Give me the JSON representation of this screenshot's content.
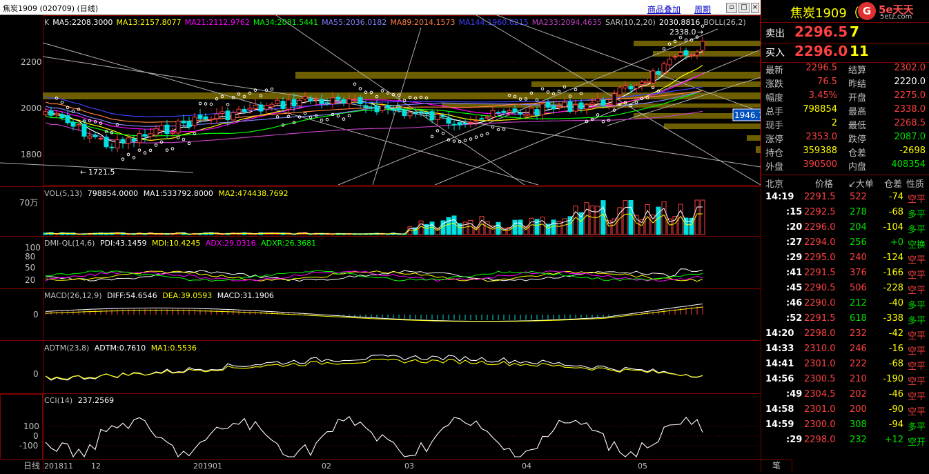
{
  "topbar": {
    "title": "焦炭1909 (020709) (日线)",
    "overlay_link": "商品叠加",
    "period_link": "周期"
  },
  "main_chart": {
    "indicator_line": [
      {
        "text": "K",
        "color": "#c0c0c0"
      },
      {
        "text": "MA5:2208.3000",
        "color": "#ffffff"
      },
      {
        "text": "MA13:2157.8077",
        "color": "#ffff00"
      },
      {
        "text": "MA21:2112.9762",
        "color": "#ff00ff"
      },
      {
        "text": "MA34:2081.5441",
        "color": "#00ff00"
      },
      {
        "text": "MA55:2036.0182",
        "color": "#8080ff"
      },
      {
        "text": "MA89:2014.1573",
        "color": "#ff8040"
      },
      {
        "text": "MA144:1960.6215",
        "color": "#4040ff"
      },
      {
        "text": "MA233:2094.4635",
        "color": "#c040c0"
      },
      {
        "text": "SAR(10,2,20)",
        "color": "#c0c0c0"
      },
      {
        "text": "2030.8816",
        "color": "#ffffff"
      },
      {
        "text": "BOLL(26,2)",
        "color": "#c0c0c0"
      }
    ],
    "y_ticks": [
      "2200",
      "2000",
      "1800"
    ],
    "high_label": "2338.0",
    "low_label": "1721.5",
    "price_tag": "1946.7"
  },
  "vol_panel": {
    "label": "VOL(5,13)",
    "value": "798854.0000",
    "ma1": "MA1:533792.8000",
    "ma2": "MA2:474438.7692",
    "y_tick": "70万"
  },
  "dmi_panel": {
    "label": "DMI-QL(14,6)",
    "pdi": "PDI:43.1459",
    "mdi": "MDI:10.4245",
    "adx": "ADX:29.0316",
    "adxr": "ADXR:26.3681",
    "y_ticks": [
      "100",
      "80",
      "50",
      "20"
    ]
  },
  "macd_panel": {
    "label": "MACD(26,12,9)",
    "diff": "DIFF:54.6546",
    "dea": "DEA:39.0593",
    "macd": "MACD:31.1906",
    "y_tick": "0"
  },
  "adtm_panel": {
    "label": "ADTM(23,8)",
    "adtm": "ADTM:0.7610",
    "ma1": "MA1:0.5536",
    "y_tick": "0"
  },
  "cci_panel": {
    "label": "CCI(14)",
    "value": "237.2569",
    "y_ticks": [
      "100",
      "0",
      "-100"
    ]
  },
  "x_axis": {
    "corner_label": "日线",
    "labels": [
      "201811",
      "12",
      "201901",
      "02",
      "03",
      "04",
      "05"
    ]
  },
  "quote": {
    "name": "焦炭1909（",
    "logo_letter": "G",
    "logo_brand": "5e天天",
    "logo_site": "5etz.com",
    "sell_label": "卖出",
    "sell_price": "2296.5",
    "sell_vol": "7",
    "buy_label": "买入",
    "buy_price": "2296.0",
    "buy_vol": "11",
    "stats": [
      {
        "l1": "最新",
        "v1": "2296.5",
        "c1": "red",
        "l2": "结算",
        "v2": "2302.0",
        "c2": "red"
      },
      {
        "l1": "涨跌",
        "v1": "76.5",
        "c1": "red",
        "l2": "昨结",
        "v2": "2220.0",
        "c2": "wht"
      },
      {
        "l1": "幅度",
        "v1": "3.45%",
        "c1": "red",
        "l2": "开盘",
        "v2": "2275.0",
        "c2": "red"
      },
      {
        "l1": "总手",
        "v1": "798854",
        "c1": "yel",
        "l2": "最高",
        "v2": "2338.0",
        "c2": "red"
      },
      {
        "l1": "现手",
        "v1": "2",
        "c1": "yel",
        "l2": "最低",
        "v2": "2268.5",
        "c2": "red"
      },
      {
        "l1": "涨停",
        "v1": "2353.0",
        "c1": "red",
        "l2": "跌停",
        "v2": "2087.0",
        "c2": "grn"
      },
      {
        "l1": "持仓",
        "v1": "359388",
        "c1": "yel",
        "l2": "仓差",
        "v2": "-2698",
        "c2": "yel"
      },
      {
        "l1": "外盘",
        "v1": "390500",
        "c1": "red",
        "l2": "内盘",
        "v2": "408354",
        "c2": "grn"
      }
    ],
    "ticks_header": {
      "city": "北京",
      "price": "价格",
      "bigorder": "↙大单",
      "oi": "仓差",
      "nature": "性质"
    },
    "ticks": [
      {
        "time": "14:19",
        "price": "2291.5",
        "vol": "522",
        "oi": "-74",
        "nature": "空平",
        "vc": "red",
        "nc": "red"
      },
      {
        "time": ":15",
        "price": "2292.5",
        "vol": "278",
        "oi": "-68",
        "nature": "多平",
        "vc": "grn",
        "nc": "grn"
      },
      {
        "time": ":20",
        "price": "2296.0",
        "vol": "204",
        "oi": "-104",
        "nature": "多平",
        "vc": "grn",
        "nc": "grn"
      },
      {
        "time": ":27",
        "price": "2294.0",
        "vol": "256",
        "oi": "+0",
        "nature": "空换",
        "vc": "grn",
        "nc": "grn"
      },
      {
        "time": ":29",
        "price": "2295.0",
        "vol": "240",
        "oi": "-124",
        "nature": "空平",
        "vc": "red",
        "nc": "red"
      },
      {
        "time": ":41",
        "price": "2291.5",
        "vol": "376",
        "oi": "-166",
        "nature": "空平",
        "vc": "red",
        "nc": "red"
      },
      {
        "time": ":45",
        "price": "2290.5",
        "vol": "506",
        "oi": "-228",
        "nature": "空平",
        "vc": "red",
        "nc": "red"
      },
      {
        "time": ":46",
        "price": "2290.0",
        "vol": "212",
        "oi": "-40",
        "nature": "多平",
        "vc": "grn",
        "nc": "grn"
      },
      {
        "time": ":52",
        "price": "2291.5",
        "vol": "618",
        "oi": "-338",
        "nature": "多平",
        "vc": "grn",
        "nc": "grn"
      },
      {
        "time": "14:20",
        "price": "2298.0",
        "vol": "232",
        "oi": "-42",
        "nature": "空平",
        "vc": "red",
        "nc": "red"
      },
      {
        "time": "14:33",
        "price": "2310.0",
        "vol": "246",
        "oi": "-16",
        "nature": "空平",
        "vc": "red",
        "nc": "red"
      },
      {
        "time": "14:41",
        "price": "2301.0",
        "vol": "222",
        "oi": "-68",
        "nature": "空平",
        "vc": "red",
        "nc": "red"
      },
      {
        "time": "14:56",
        "price": "2300.5",
        "vol": "210",
        "oi": "-190",
        "nature": "空平",
        "vc": "red",
        "nc": "red"
      },
      {
        "time": ":49",
        "price": "2304.5",
        "vol": "202",
        "oi": "-46",
        "nature": "空平",
        "vc": "red",
        "nc": "red"
      },
      {
        "time": "14:58",
        "price": "2301.0",
        "vol": "200",
        "oi": "-90",
        "nature": "空平",
        "vc": "red",
        "nc": "red"
      },
      {
        "time": "14:59",
        "price": "2300.0",
        "vol": "308",
        "oi": "-94",
        "nature": "多平",
        "vc": "grn",
        "nc": "grn"
      },
      {
        "time": ":29",
        "price": "2298.0",
        "vol": "232",
        "oi": "+12",
        "nature": "空开",
        "vc": "grn",
        "nc": "grn"
      }
    ],
    "bottom_tab": "笔"
  },
  "colors": {
    "up": "#ff4040",
    "down": "#00e0e0",
    "grid": "#800000",
    "bg": "#000000"
  }
}
